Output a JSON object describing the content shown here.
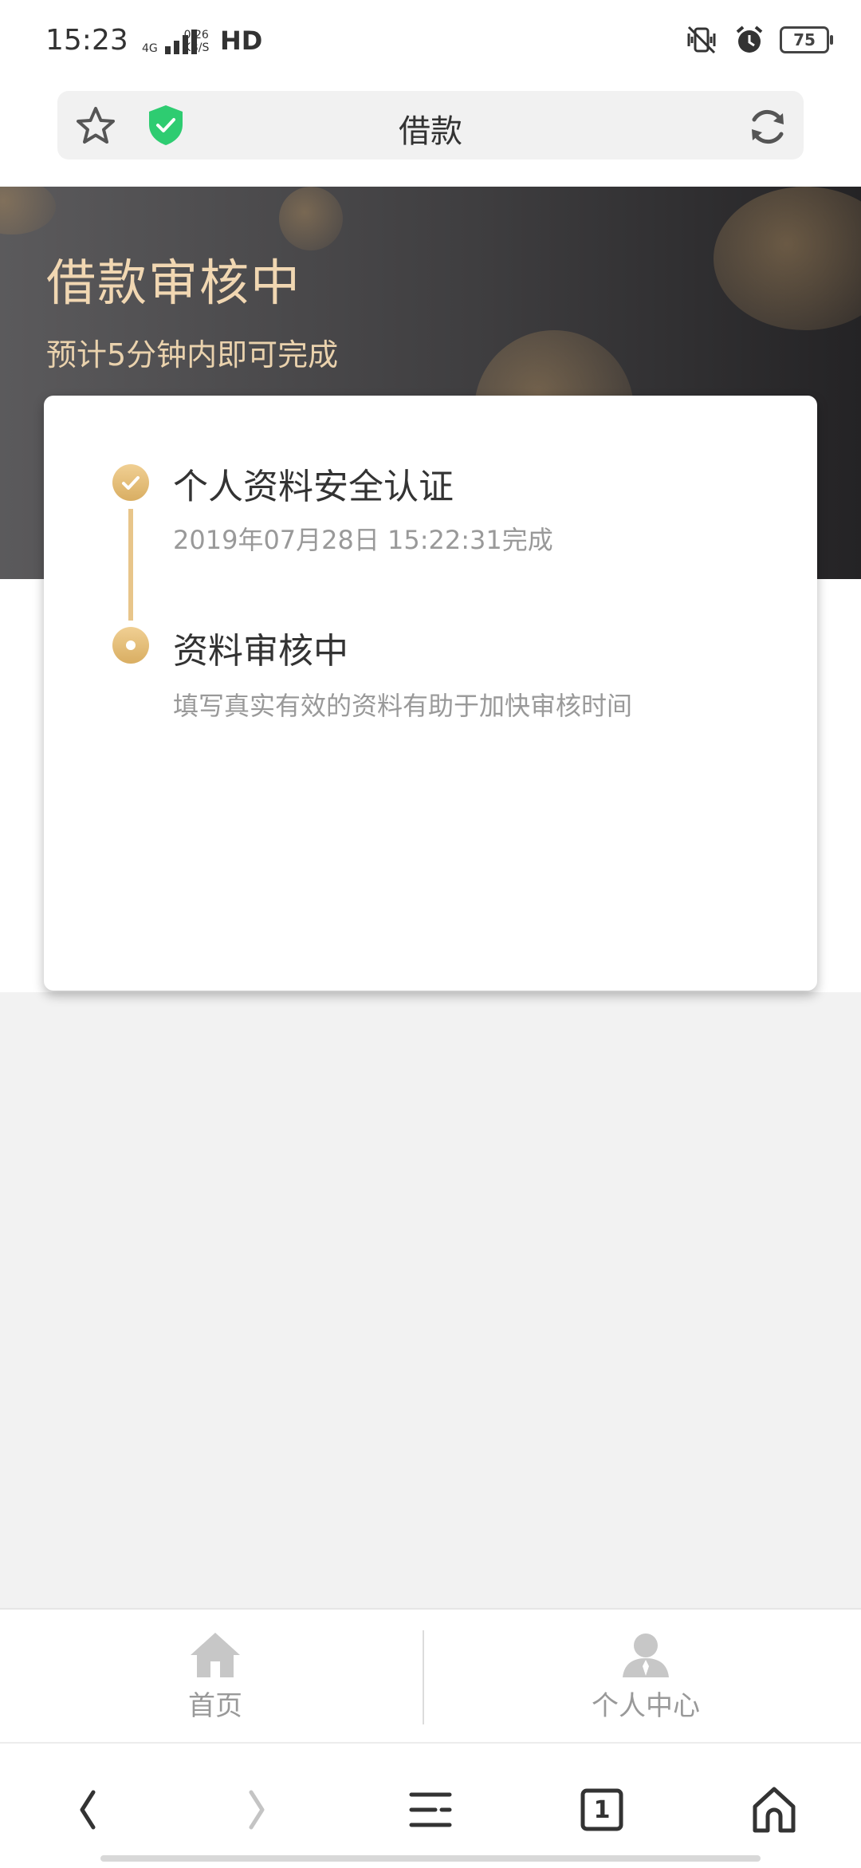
{
  "status_bar": {
    "time": "15:23",
    "network": "4G",
    "speed_value": "0.26",
    "speed_unit": "KB/S",
    "hd": "HD",
    "battery": "75"
  },
  "address_bar": {
    "title": "借款",
    "shield_color": "#2ecc71"
  },
  "banner": {
    "title": "借款审核中",
    "subtitle": "预计5分钟内即可完成"
  },
  "steps": [
    {
      "title": "个人资料安全认证",
      "desc": "2019年07月28日 15:22:31完成",
      "status": "done"
    },
    {
      "title": "资料审核中",
      "desc": "填写真实有效的资料有助于加快审核时间",
      "status": "current"
    }
  ],
  "tabbar": {
    "tabs": [
      {
        "label": "首页",
        "icon": "home-icon"
      },
      {
        "label": "个人中心",
        "icon": "person-icon"
      }
    ]
  },
  "browser_nav": {
    "tab_count": "1"
  },
  "colors": {
    "accent_gold": "#e8c58a",
    "banner_text": "#f1d7b2"
  }
}
